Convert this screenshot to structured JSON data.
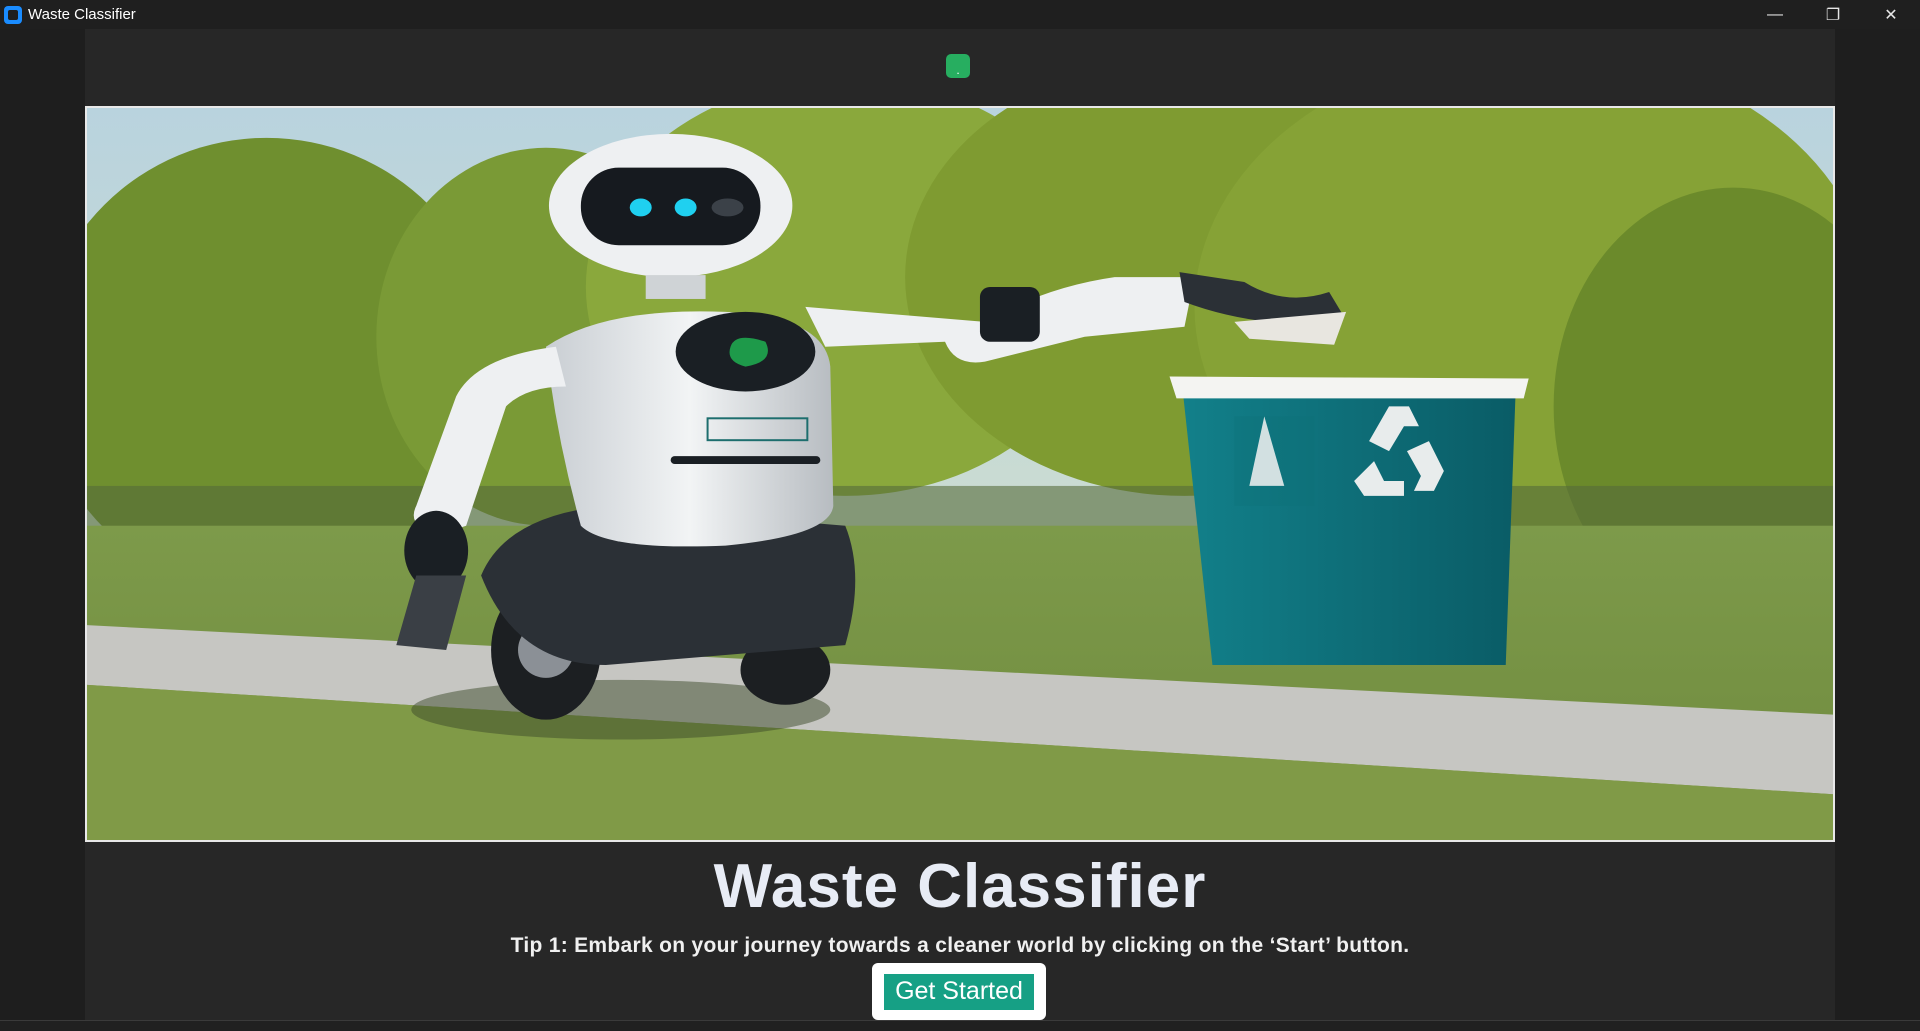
{
  "window": {
    "title": "Waste Classifier",
    "controls": {
      "minimize": "—",
      "maximize": "❐",
      "close": "✕"
    }
  },
  "header": {
    "indicator_text": "."
  },
  "hero": {
    "image_subject": "robot placing trash into recycling bin",
    "bin_color": "#0d6e78",
    "recycle_icon": "recycle-icon"
  },
  "main": {
    "title": "Waste Classifier",
    "tip": "Tip 1: Embark on your journey towards a cleaner world by clicking on the ‘Start’ button.",
    "start_button": "Get Started"
  },
  "colors": {
    "accent": "#16a085",
    "indicator": "#27ae60",
    "background": "#272727"
  }
}
